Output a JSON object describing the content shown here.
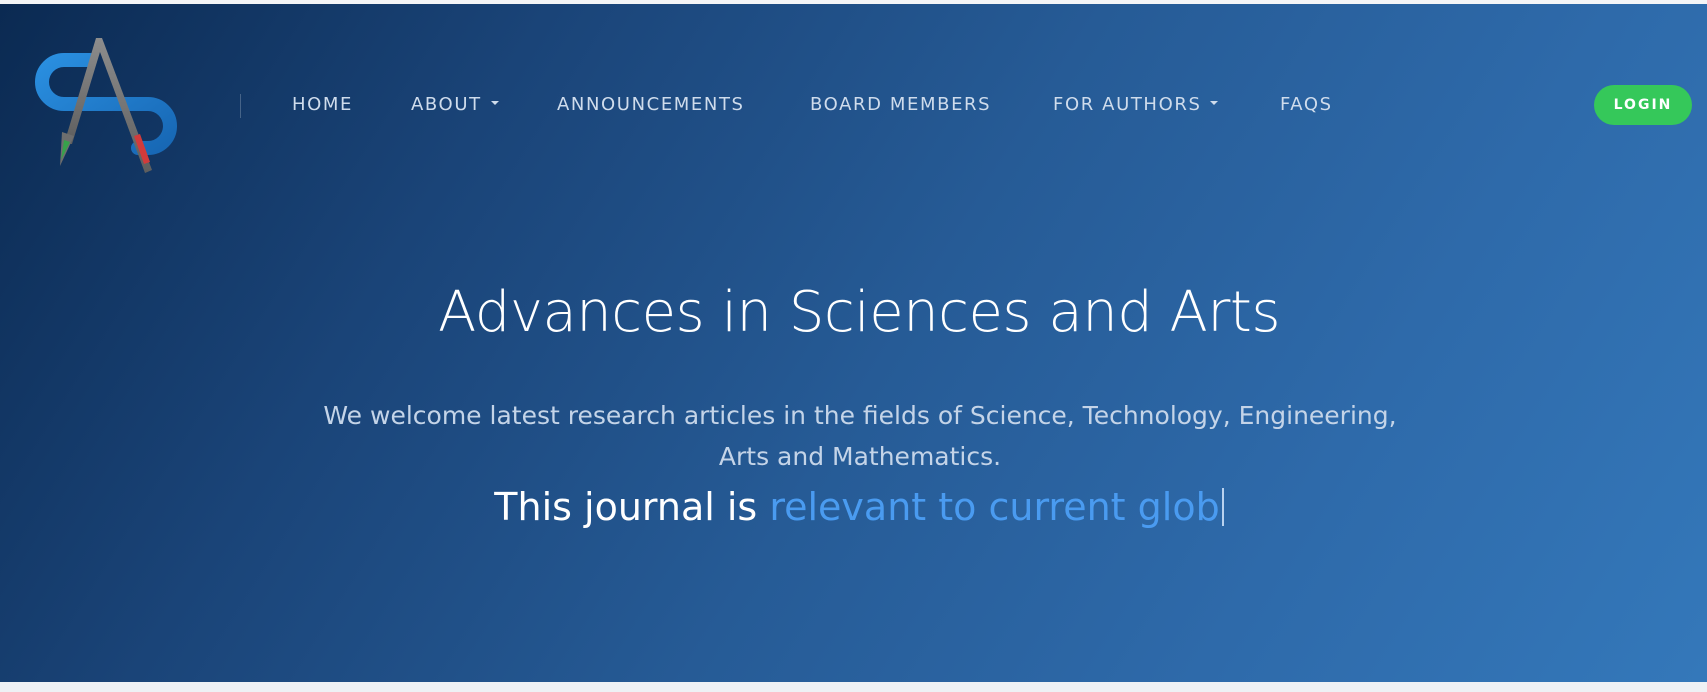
{
  "brand": {
    "logo_icon": "sa-monogram-pen-logo",
    "colors": {
      "logo_blue": "#1f80d0",
      "logo_gray": "#7a7a7a",
      "logo_green": "#37a24b",
      "logo_red": "#d23b3b"
    }
  },
  "nav": {
    "items": [
      {
        "label": "HOME",
        "has_dropdown": false
      },
      {
        "label": "ABOUT",
        "has_dropdown": true
      },
      {
        "label": "ANNOUNCEMENTS",
        "has_dropdown": false
      },
      {
        "label": "BOARD MEMBERS",
        "has_dropdown": false
      },
      {
        "label": "FOR AUTHORS",
        "has_dropdown": true
      },
      {
        "label": "FAQS",
        "has_dropdown": false
      }
    ],
    "dropdown_icon": "caret-down-icon",
    "login_label": "LOGIN"
  },
  "hero": {
    "title": "Advances in Sciences and Arts",
    "description": "We welcome latest research articles in the fields of Science, Technology, Engineering, Arts and Mathematics.",
    "typed_prefix": "This journal is ",
    "typed_text": "relevant to current glob"
  },
  "colors": {
    "hero_gradient_start": "#0b2a52",
    "hero_gradient_end": "#3478ba",
    "login_button": "#35c85a",
    "typed_highlight": "#4a9bf0"
  }
}
